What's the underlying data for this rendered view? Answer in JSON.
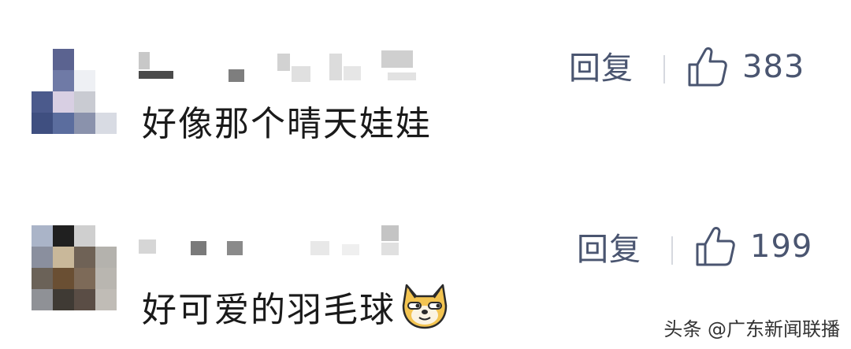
{
  "comments": [
    {
      "text": "好像那个晴天娃娃",
      "reply_label": "回复",
      "like_count": "383",
      "like_icon": "thumbs-up-icon",
      "avatar_colors": [
        "#ffffff",
        "#5b6390",
        "#ffffff",
        "#ffffff",
        "#ffffff",
        "#6f7aa6",
        "#eef0f4",
        "#ffffff",
        "#4b5a8c",
        "#d8cfe3",
        "#c9cbd2",
        "#ffffff",
        "#3f4f80",
        "#5b6d9e",
        "#8a92ac",
        "#d8dbe3"
      ]
    },
    {
      "text": "好可爱的羽毛球",
      "reply_label": "回复",
      "like_count": "199",
      "like_icon": "thumbs-up-icon",
      "emoji": "doge-emoji-icon",
      "avatar_colors": [
        "#aab4c8",
        "#202020",
        "#cfcfcf",
        "#ffffff",
        "#8a8f9e",
        "#c9b89a",
        "#6f6256",
        "#b4b2ad",
        "#6b6258",
        "#6a4f33",
        "#7d6a58",
        "#b9b6b0",
        "#8f9196",
        "#3f3a34",
        "#5a4d45",
        "#c0bcb6"
      ]
    }
  ],
  "watermark": {
    "text": "头条 @广东新闻联播"
  },
  "colors": {
    "meta": "#4a5570",
    "text": "#1a1a1a",
    "divider": "#d6d9df"
  }
}
